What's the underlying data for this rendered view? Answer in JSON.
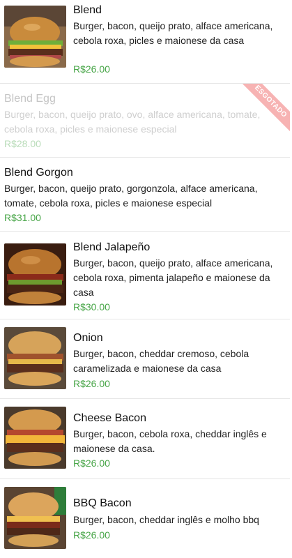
{
  "items": [
    {
      "title": "Blend",
      "description": "Burger, bacon, queijo prato, alface americana, cebola roxa, picles e maionese da casa",
      "price": "R$26.00"
    },
    {
      "title": "Blend Egg",
      "description": "Burger, bacon, queijo prato, ovo, alface americana, tomate, cebola roxa, picles e maionese especial",
      "price": "R$28.00",
      "badge": "ESGOTADO"
    },
    {
      "title": "Blend Gorgon",
      "description": "Burger, bacon, queijo prato, gorgonzola, alface americana, tomate, cebola roxa, picles e maionese especial",
      "price": "R$31.00"
    },
    {
      "title": "Blend Jalapeño",
      "description": "Burger, bacon, queijo prato, alface americana, cebola roxa, pimenta jalapeño e maionese da casa",
      "price": "R$30.00"
    },
    {
      "title": "Onion",
      "description": "Burger, bacon, cheddar cremoso, cebola caramelizada e maionese da casa",
      "price": "R$26.00"
    },
    {
      "title": "Cheese Bacon",
      "description": "Burger, bacon, cebola roxa, cheddar inglês e maionese da casa.",
      "price": "R$26.00"
    },
    {
      "title": "BBQ Bacon",
      "description": "Burger, bacon, cheddar inglês e molho bbq",
      "price": "R$26.00"
    }
  ],
  "colors": {
    "price": "#47a547",
    "sold_out_ribbon": "#f7b3b3"
  }
}
